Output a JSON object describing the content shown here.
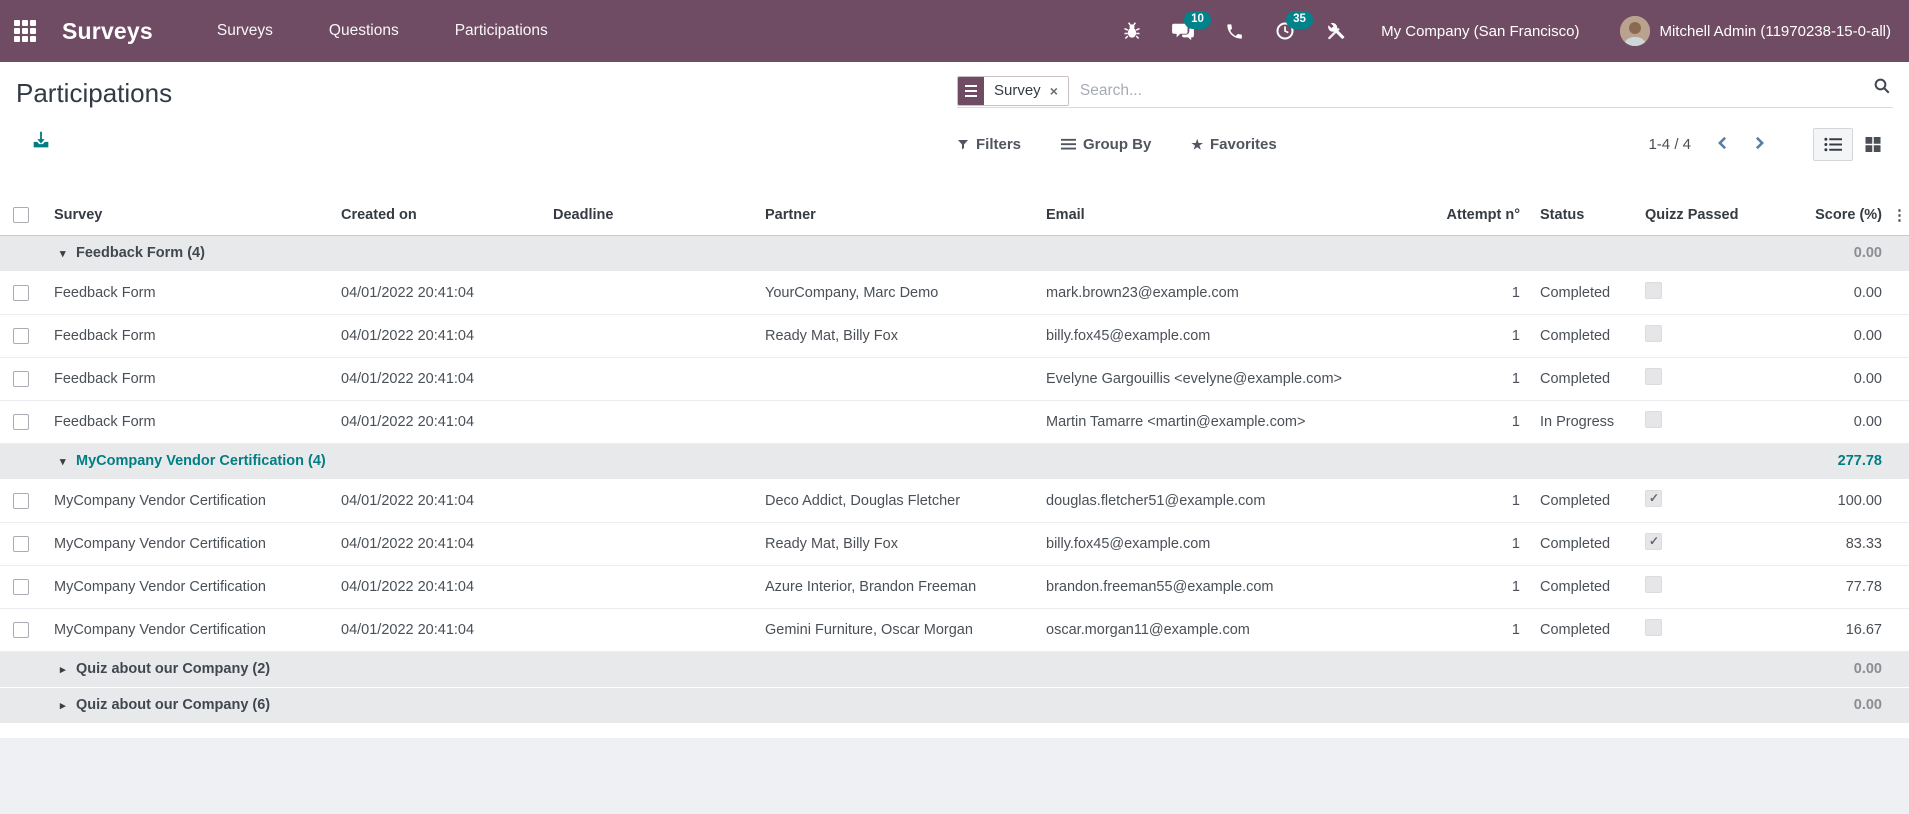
{
  "navbar": {
    "app_name": "Surveys",
    "menu": [
      {
        "label": "Surveys"
      },
      {
        "label": "Questions"
      },
      {
        "label": "Participations"
      }
    ],
    "messages_badge": "10",
    "activities_badge": "35",
    "company": "My Company (San Francisco)",
    "user": "Mitchell Admin (11970238-15-0-all)"
  },
  "control_panel": {
    "title": "Participations",
    "search": {
      "facet_label": "Survey",
      "facet_remove": "×",
      "placeholder": "Search..."
    },
    "buttons": {
      "filters": "Filters",
      "group_by": "Group By",
      "favorites": "Favorites"
    },
    "pager": {
      "value": "1-4 / 4"
    }
  },
  "table": {
    "columns": [
      "Survey",
      "Created on",
      "Deadline",
      "Partner",
      "Email",
      "Attempt n°",
      "Status",
      "Quizz Passed",
      "Score (%)"
    ],
    "more_icon": "⋮",
    "groups": [
      {
        "label": "Feedback Form (4)",
        "expanded": true,
        "accent": false,
        "score": "0.00",
        "rows": [
          {
            "survey": "Feedback Form",
            "created_on": "04/01/2022 20:41:04",
            "deadline": "",
            "partner": "YourCompany, Marc Demo",
            "email": "mark.brown23@example.com",
            "attempt": "1",
            "status": "Completed",
            "quizz_passed": false,
            "score": "0.00"
          },
          {
            "survey": "Feedback Form",
            "created_on": "04/01/2022 20:41:04",
            "deadline": "",
            "partner": "Ready Mat, Billy Fox",
            "email": "billy.fox45@example.com",
            "attempt": "1",
            "status": "Completed",
            "quizz_passed": false,
            "score": "0.00"
          },
          {
            "survey": "Feedback Form",
            "created_on": "04/01/2022 20:41:04",
            "deadline": "",
            "partner": "",
            "email": "Evelyne Gargouillis <evelyne@example.com>",
            "attempt": "1",
            "status": "Completed",
            "quizz_passed": false,
            "score": "0.00"
          },
          {
            "survey": "Feedback Form",
            "created_on": "04/01/2022 20:41:04",
            "deadline": "",
            "partner": "",
            "email": "Martin Tamarre <martin@example.com>",
            "attempt": "1",
            "status": "In Progress",
            "quizz_passed": false,
            "score": "0.00"
          }
        ]
      },
      {
        "label": "MyCompany Vendor Certification (4)",
        "expanded": true,
        "accent": true,
        "score": "277.78",
        "rows": [
          {
            "survey": "MyCompany Vendor Certification",
            "created_on": "04/01/2022 20:41:04",
            "deadline": "",
            "partner": "Deco Addict, Douglas Fletcher",
            "email": "douglas.fletcher51@example.com",
            "attempt": "1",
            "status": "Completed",
            "quizz_passed": true,
            "score": "100.00"
          },
          {
            "survey": "MyCompany Vendor Certification",
            "created_on": "04/01/2022 20:41:04",
            "deadline": "",
            "partner": "Ready Mat, Billy Fox",
            "email": "billy.fox45@example.com",
            "attempt": "1",
            "status": "Completed",
            "quizz_passed": true,
            "score": "83.33"
          },
          {
            "survey": "MyCompany Vendor Certification",
            "created_on": "04/01/2022 20:41:04",
            "deadline": "",
            "partner": "Azure Interior, Brandon Freeman",
            "email": "brandon.freeman55@example.com",
            "attempt": "1",
            "status": "Completed",
            "quizz_passed": false,
            "score": "77.78"
          },
          {
            "survey": "MyCompany Vendor Certification",
            "created_on": "04/01/2022 20:41:04",
            "deadline": "",
            "partner": "Gemini Furniture, Oscar Morgan",
            "email": "oscar.morgan11@example.com",
            "attempt": "1",
            "status": "Completed",
            "quizz_passed": false,
            "score": "16.67"
          }
        ]
      },
      {
        "label": "Quiz about our Company (2)",
        "expanded": false,
        "accent": false,
        "score": "0.00",
        "rows": []
      },
      {
        "label": "Quiz about our Company (6)",
        "expanded": false,
        "accent": false,
        "score": "0.00",
        "rows": []
      }
    ]
  },
  "icons": {
    "caret_down": "▾",
    "caret_right": "▸",
    "check": "✓",
    "close": "×",
    "kebab": "⋮",
    "star": "★"
  },
  "colors": {
    "navbar": "#6F4C63",
    "badge_teal": "#00838a",
    "accent_teal": "#017e84",
    "group_row_bg": "#e8e9eb",
    "text": "#4a5057"
  }
}
